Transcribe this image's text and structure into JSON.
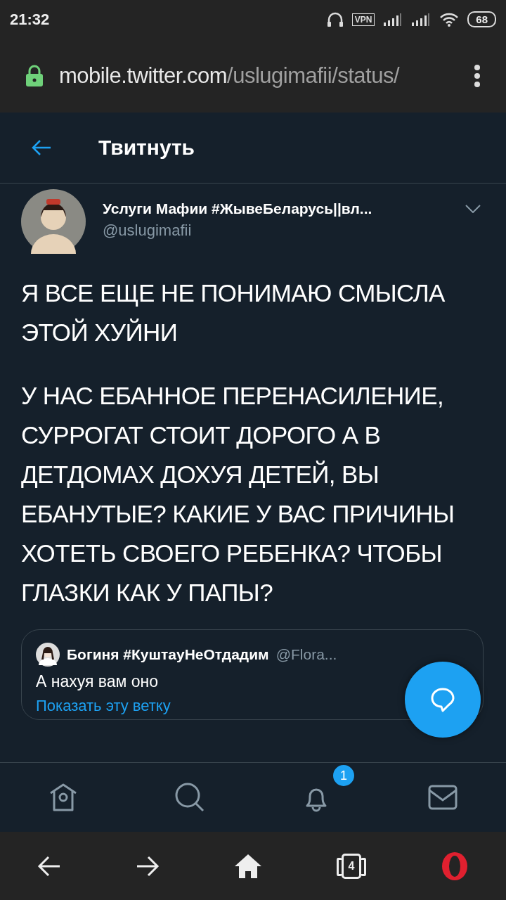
{
  "status_bar": {
    "time": "21:32",
    "vpn": "VPN",
    "battery": "68"
  },
  "browser": {
    "url_host": "mobile.twitter.com",
    "url_path": "/uslugimafii/status/",
    "tab_count": "4"
  },
  "header": {
    "title": "Твитнуть"
  },
  "tweet": {
    "name": "Услуги Мафии #ЖывеБеларусь||вл...",
    "handle": "@uslugimafii",
    "paragraphs": [
      "Я ВСЕ ЕЩЕ НЕ ПОНИМАЮ СМЫСЛА ЭТОЙ ХУЙНИ",
      "У НАС ЕБАННОЕ ПЕРЕНАСИЛЕНИЕ, СУРРОГАТ СТОИТ ДОРОГО А В ДЕТДОМАХ ДОХУЯ ДЕТЕЙ, ВЫ ЕБАНУТЫЕ? КАКИЕ У ВАС ПРИЧИНЫ ХОТЕТЬ СВОЕГО РЕБЕНКА? ЧТОБЫ ГЛАЗКИ КАК У ПАПЫ?"
    ],
    "quote": {
      "name": "Богиня #КуштауНеОтдадим",
      "handle": "@Flora...",
      "text": "А нахуя вам оно",
      "link": "Показать эту ветку"
    }
  },
  "bottom_nav": [
    {
      "kind": "home"
    },
    {
      "kind": "search"
    },
    {
      "kind": "notifications",
      "badge": "1"
    },
    {
      "kind": "messages"
    }
  ]
}
